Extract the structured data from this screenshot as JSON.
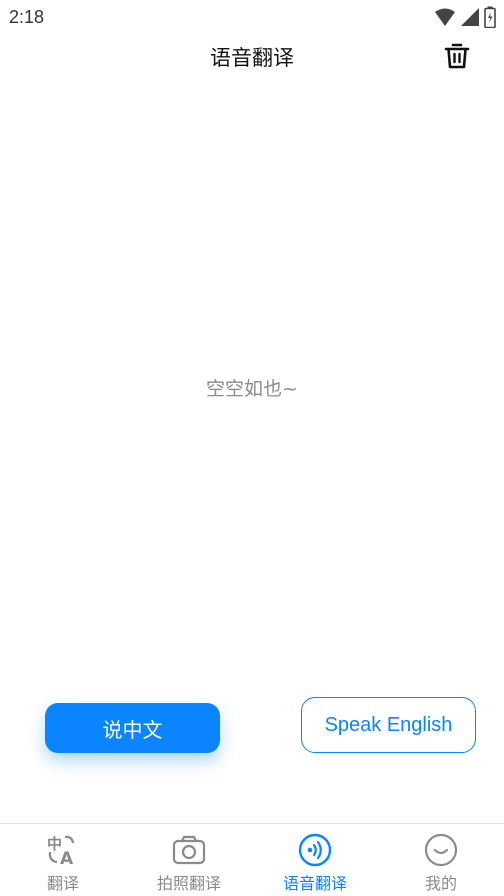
{
  "status_bar": {
    "time": "2:18"
  },
  "header": {
    "title": "语音翻译"
  },
  "main": {
    "empty_text": "空空如也~"
  },
  "buttons": {
    "speak_chinese": "说中文",
    "speak_english": "Speak English"
  },
  "tabs": [
    {
      "label": "翻译",
      "icon": "translate-icon",
      "active": false
    },
    {
      "label": "拍照翻译",
      "icon": "camera-icon",
      "active": false
    },
    {
      "label": "语音翻译",
      "icon": "voice-icon",
      "active": true
    },
    {
      "label": "我的",
      "icon": "smiley-icon",
      "active": false
    }
  ],
  "colors": {
    "accent": "#0a84ff",
    "inactive": "#8a8a8a"
  }
}
